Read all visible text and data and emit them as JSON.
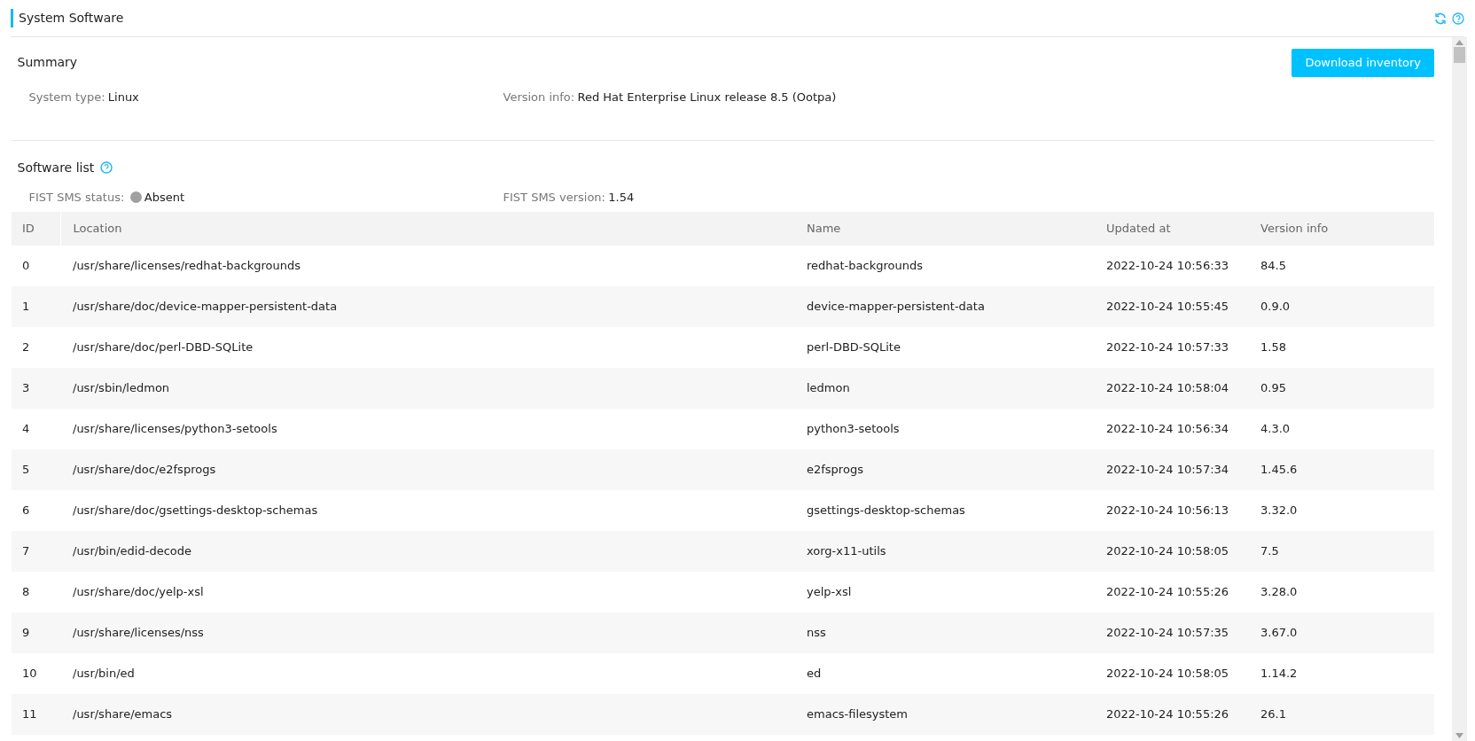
{
  "header": {
    "title": "System Software"
  },
  "summary": {
    "title": "Summary",
    "button": "Download inventory",
    "fields": [
      {
        "label": "System type:",
        "value": "Linux"
      },
      {
        "label": "Version info:",
        "value": "Red Hat Enterprise Linux release 8.5 (Ootpa)"
      }
    ]
  },
  "software_list": {
    "title": "Software list",
    "status": {
      "label": "FIST SMS status:",
      "value": "Absent",
      "color": "#a0a0a0"
    },
    "version": {
      "label": "FIST SMS version:",
      "value": "1.54"
    }
  },
  "table": {
    "columns": [
      "ID",
      "Location",
      "Name",
      "Updated at",
      "Version info"
    ],
    "rows": [
      [
        "0",
        "/usr/share/licenses/redhat-backgrounds",
        "redhat-backgrounds",
        "2022-10-24 10:56:33",
        "84.5"
      ],
      [
        "1",
        "/usr/share/doc/device-mapper-persistent-data",
        "device-mapper-persistent-data",
        "2022-10-24 10:55:45",
        "0.9.0"
      ],
      [
        "2",
        "/usr/share/doc/perl-DBD-SQLite",
        "perl-DBD-SQLite",
        "2022-10-24 10:57:33",
        "1.58"
      ],
      [
        "3",
        "/usr/sbin/ledmon",
        "ledmon",
        "2022-10-24 10:58:04",
        "0.95"
      ],
      [
        "4",
        "/usr/share/licenses/python3-setools",
        "python3-setools",
        "2022-10-24 10:56:34",
        "4.3.0"
      ],
      [
        "5",
        "/usr/share/doc/e2fsprogs",
        "e2fsprogs",
        "2022-10-24 10:57:34",
        "1.45.6"
      ],
      [
        "6",
        "/usr/share/doc/gsettings-desktop-schemas",
        "gsettings-desktop-schemas",
        "2022-10-24 10:56:13",
        "3.32.0"
      ],
      [
        "7",
        "/usr/bin/edid-decode",
        "xorg-x11-utils",
        "2022-10-24 10:58:05",
        "7.5"
      ],
      [
        "8",
        "/usr/share/doc/yelp-xsl",
        "yelp-xsl",
        "2022-10-24 10:55:26",
        "3.28.0"
      ],
      [
        "9",
        "/usr/share/licenses/nss",
        "nss",
        "2022-10-24 10:57:35",
        "3.67.0"
      ],
      [
        "10",
        "/usr/bin/ed",
        "ed",
        "2022-10-24 10:58:05",
        "1.14.2"
      ],
      [
        "11",
        "/usr/share/emacs",
        "emacs-filesystem",
        "2022-10-24 10:55:26",
        "26.1"
      ]
    ]
  }
}
